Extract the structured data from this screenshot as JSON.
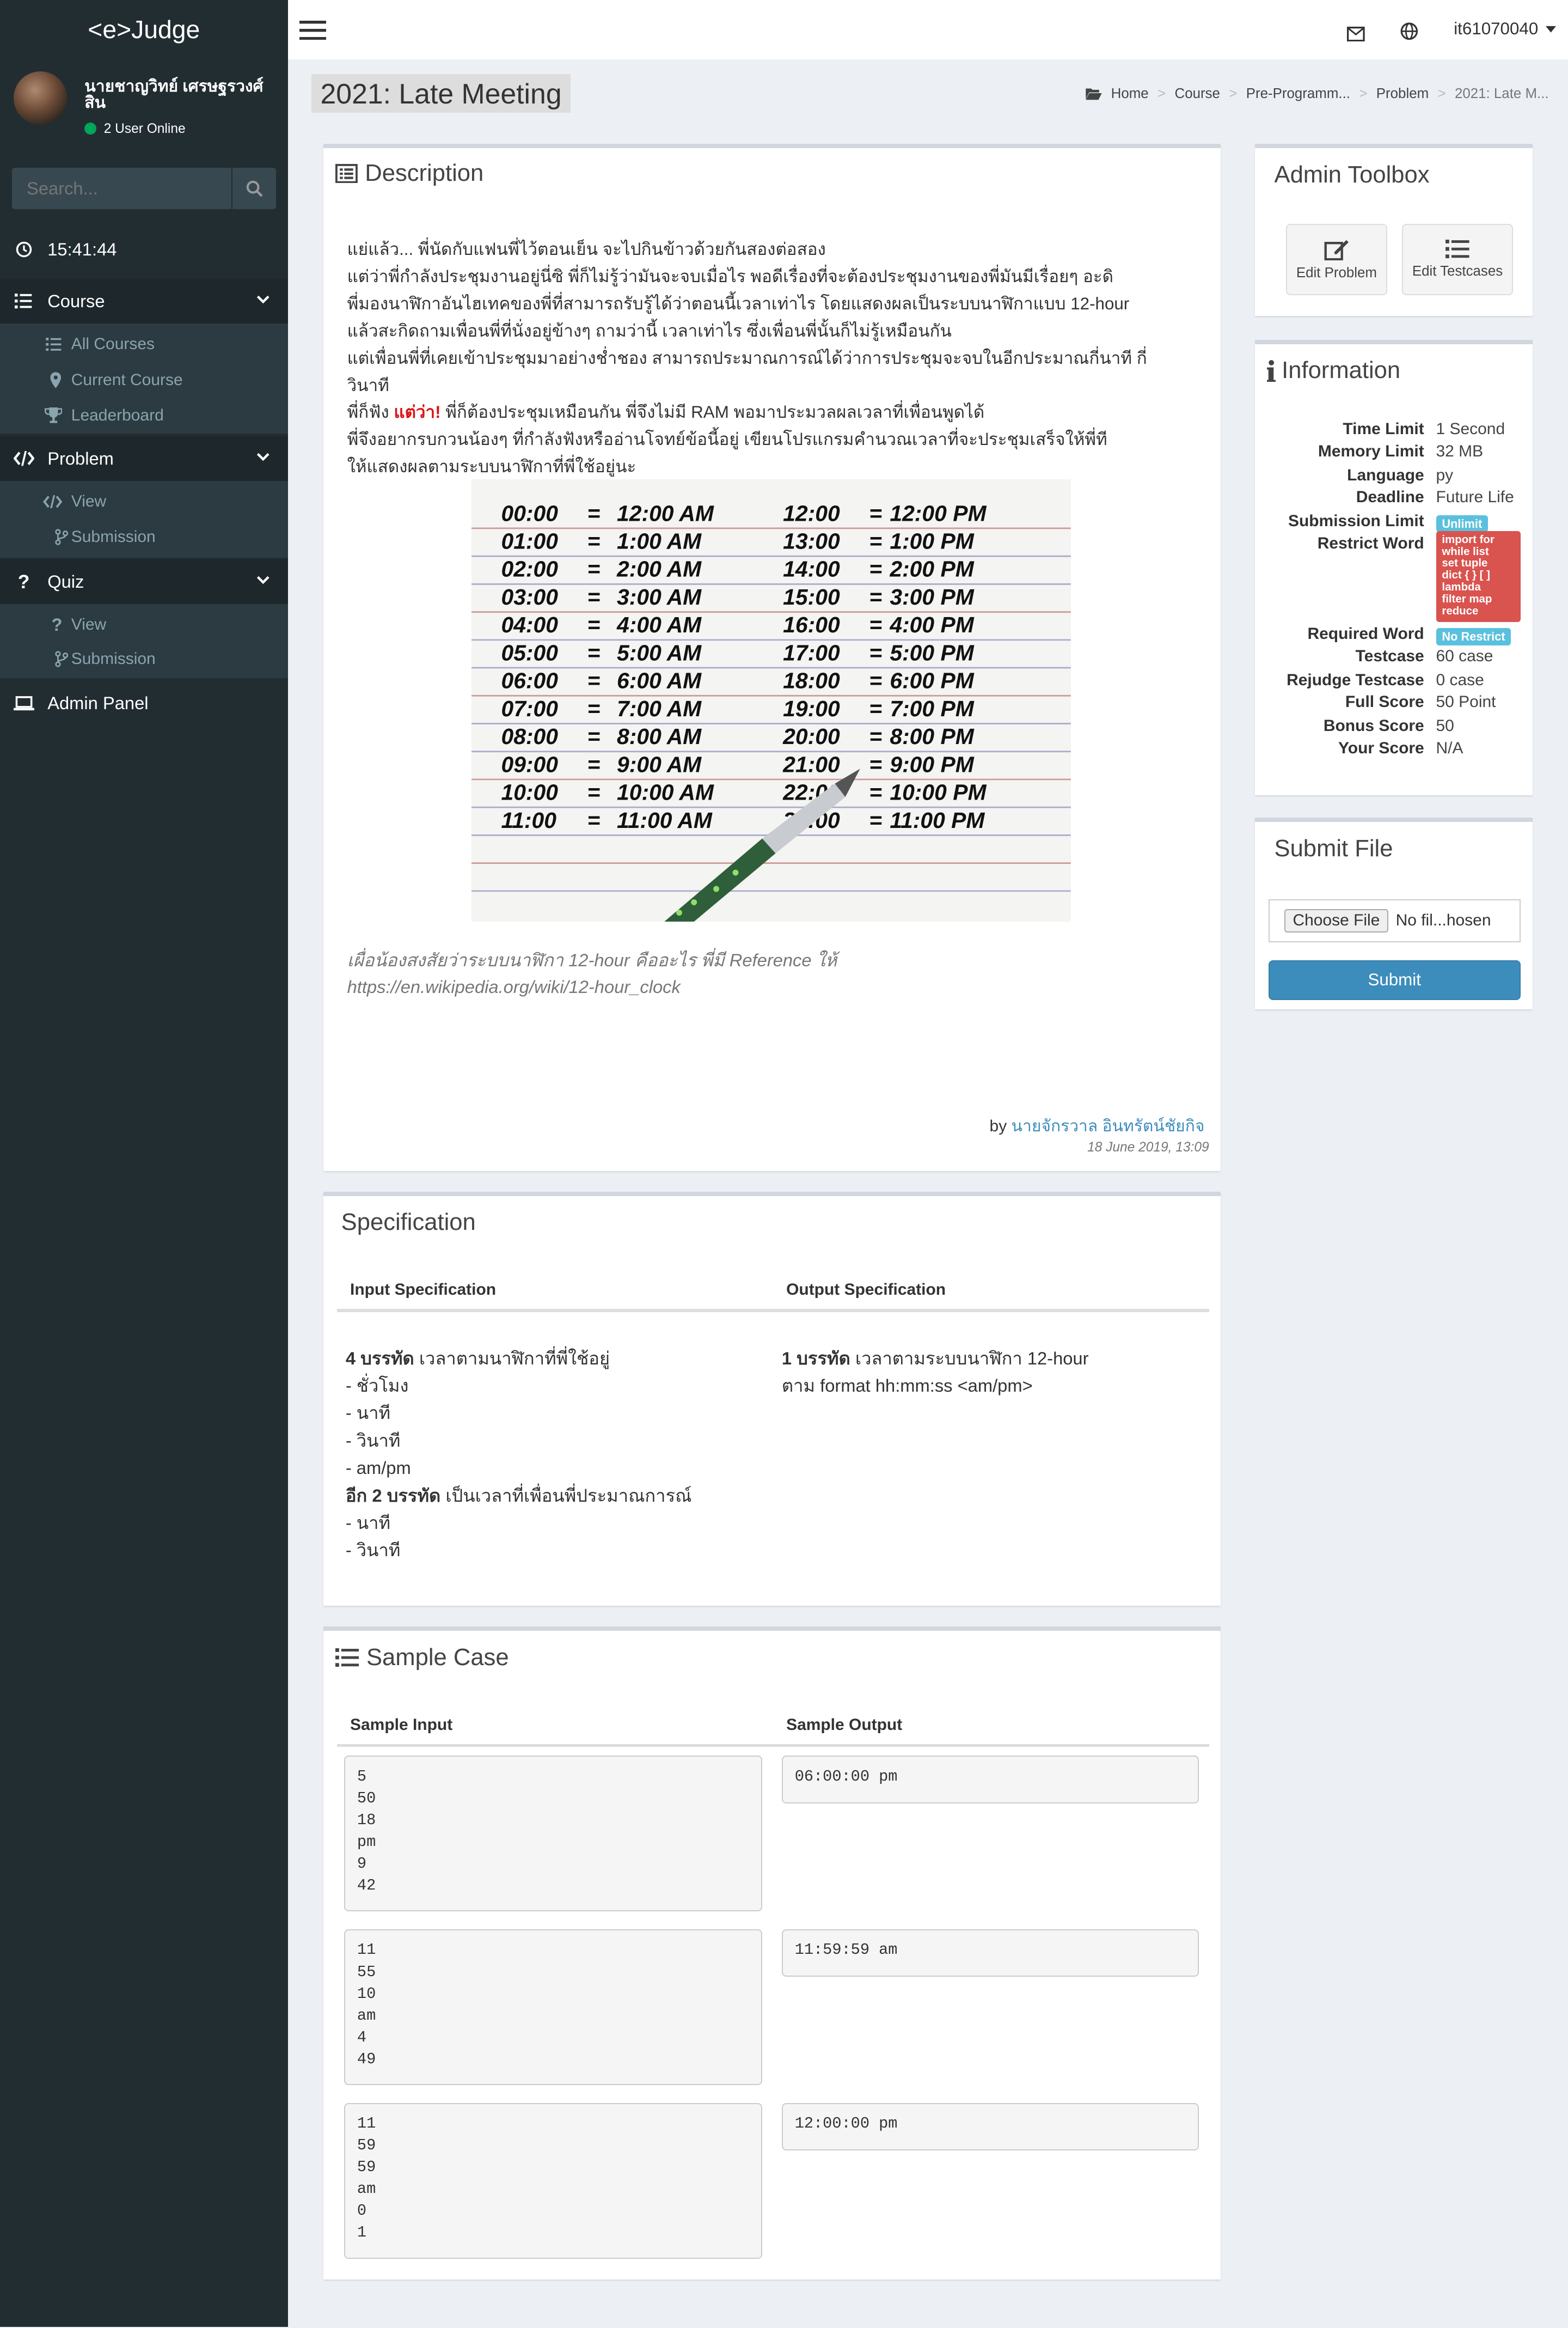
{
  "app": {
    "logo": "<e>Judge",
    "clock": "15:41:44"
  },
  "user": {
    "name": "นายชาญวิทย์ เศรษฐรวงศ์สิน",
    "online": "2 User Online",
    "account": "it61070040"
  },
  "search": {
    "placeholder": "Search..."
  },
  "sidebar": {
    "course": "Course",
    "course_items": [
      "All Courses",
      "Current Course",
      "Leaderboard"
    ],
    "problem": "Problem",
    "problem_items": [
      "View",
      "Submission"
    ],
    "quiz": "Quiz",
    "quiz_items": [
      "View",
      "Submission"
    ],
    "admin": "Admin Panel"
  },
  "page": {
    "title": "2021: Late Meeting"
  },
  "breadcrumb": [
    "Home",
    "Course",
    "Pre-Programm...",
    "Problem",
    "2021: Late M..."
  ],
  "description": {
    "heading": "Description",
    "lines": [
      "แย่แล้ว... พี่นัดกับแฟนพี่ไว้ตอนเย็น จะไปกินข้าวด้วยกันสองต่อสอง",
      "แต่ว่าพี่กำลังประชุมงานอยู่นี่ซิ พี่ก็ไม่รู้ว่ามันจะจบเมื่อไร พอดีเรื่องที่จะต้องประชุมงานของพี่มันมีเรื่อยๆ อะดิ",
      "พี่มองนาฬิกาอันไฮเทคของพี่ที่สามารถรับรู้ได้ว่าตอนนี้เวลาเท่าไร โดยแสดงผลเป็นระบบนาฬิกาแบบ 12-hour",
      "แล้วสะกิดถามเพื่อนพี่ที่นั่งอยู่ข้างๆ ถามว่านี้ เวลาเท่าไร ซึ่งเพื่อนพี่นั้นก็ไม่รู้เหมือนกัน",
      "แต่เพื่อนพี่ที่เคยเข้าประชุมมาอย่างช่ำชอง สามารถประมาณการณ์ได้ว่าการประชุมจะจบในอีกประมาณกี่นาที กี่",
      "วินาที"
    ],
    "line7_pre": "พี่ก็ฟัง ",
    "line7_red": "แต่ว่า!",
    "line7_post": " พี่ก็ต้องประชุมเหมือนกัน พี่จึงไม่มี RAM พอมาประมวลผลเวลาที่เพื่อนพูดได้",
    "line8": "พี่จึงอยากรบกวนน้องๆ ที่กำลังฟังหรืออ่านโจทย์ข้อนี้อยู่ เขียนโปรแกรมคำนวณเวลาที่จะประชุมเสร็จให้พี่ที",
    "line9": "ให้แสดงผลตามระบบนาฬิกาที่พี่ใช้อยู่นะ",
    "note_line1": "เผื่อน้องสงสัยว่าระบบนาฬิกา 12-hour คืออะไร พี่มี Reference ให้",
    "note_line2": "https://en.wikipedia.org/wiki/12-hour_clock",
    "by": "by",
    "author": "นายจักรวาล อินทรัตน์ชัยกิจ",
    "date": "18 June 2019, 13:09",
    "image_left": [
      "00:00",
      "01:00",
      "02:00",
      "03:00",
      "04:00",
      "05:00",
      "06:00",
      "07:00",
      "08:00",
      "09:00",
      "10:00",
      "11:00"
    ],
    "image_mid": [
      "12:00 AM",
      "1:00 AM",
      "2:00 AM",
      "3:00 AM",
      "4:00 AM",
      "5:00 AM",
      "6:00 AM",
      "7:00 AM",
      "8:00 AM",
      "9:00 AM",
      "10:00 AM",
      "11:00 AM"
    ],
    "image_right": [
      "12:00",
      "13:00",
      "14:00",
      "15:00",
      "16:00",
      "17:00",
      "18:00",
      "19:00",
      "20:00",
      "21:00",
      "22:00",
      "23:00"
    ],
    "image_far": [
      "12:00 PM",
      "1:00 PM",
      "2:00 PM",
      "3:00 PM",
      "4:00 PM",
      "5:00 PM",
      "6:00 PM",
      "7:00 PM",
      "8:00 PM",
      "9:00 PM",
      "10:00 PM",
      "11:00 PM"
    ]
  },
  "toolbox": {
    "heading": "Admin Toolbox",
    "edit_problem": "Edit Problem",
    "edit_testcases": "Edit Testcases"
  },
  "information": {
    "heading": "Information",
    "time_limit_label": "Time Limit",
    "time_limit": "1 Second",
    "memory_limit_label": "Memory Limit",
    "memory_limit": "32 MB",
    "language_label": "Language",
    "language": "py",
    "deadline_label": "Deadline",
    "deadline": "Future Life",
    "submission_limit_label": "Submission Limit",
    "submission_limit": "Unlimit",
    "restrict_word_label": "Restrict Word",
    "restrict_words": [
      "import for",
      "while list",
      "set tuple",
      "dict { } [ ]",
      "lambda",
      "filter map",
      "reduce"
    ],
    "required_word_label": "Required Word",
    "required_word": "No Restrict",
    "testcase_label": "Testcase",
    "testcase": "60 case",
    "rejudge_label": "Rejudge Testcase",
    "rejudge": "0 case",
    "full_score_label": "Full Score",
    "full_score": "50 Point",
    "bonus_score_label": "Bonus Score",
    "bonus_score": "50",
    "your_score_label": "Your Score",
    "your_score": "N/A"
  },
  "submit": {
    "heading": "Submit File",
    "choose": "Choose File",
    "no_file": "No fil...hosen",
    "button": "Submit"
  },
  "specification": {
    "heading": "Specification",
    "input_header": "Input Specification",
    "output_header": "Output Specification",
    "input_b1": "4 บรรทัด",
    "input_t1": " เวลาตามนาฬิกาที่พี่ใช้อยู่",
    "input_items1": [
      "- ชั่วโมง",
      "- นาที",
      "- วินาที",
      "- am/pm"
    ],
    "input_b2": "อีก 2 บรรทัด",
    "input_t2": " เป็นเวลาที่เพื่อนพี่ประมาณการณ์",
    "input_items2": [
      "- นาที",
      "- วินาที"
    ],
    "output_b1": "1 บรรทัด",
    "output_t1": " เวลาตามระบบนาฬิกา 12-hour",
    "output_line2": "ตาม format hh:mm:ss <am/pm>"
  },
  "samples": {
    "heading": "Sample Case",
    "input_header": "Sample Input",
    "output_header": "Sample Output",
    "cases": [
      {
        "input": "5\n50\n18\npm\n9\n42",
        "output": "06:00:00 pm"
      },
      {
        "input": "11\n55\n10\nam\n4\n49",
        "output": "11:59:59 am"
      },
      {
        "input": "11\n59\n59\nam\n0\n1",
        "output": "12:00:00 pm"
      }
    ]
  },
  "colors": {
    "sidebar": "#222d32",
    "accent": "#3c8dbc",
    "badge_info": "#5bc0de",
    "badge_danger": "#d9534f",
    "link": "#3c8dbc"
  }
}
